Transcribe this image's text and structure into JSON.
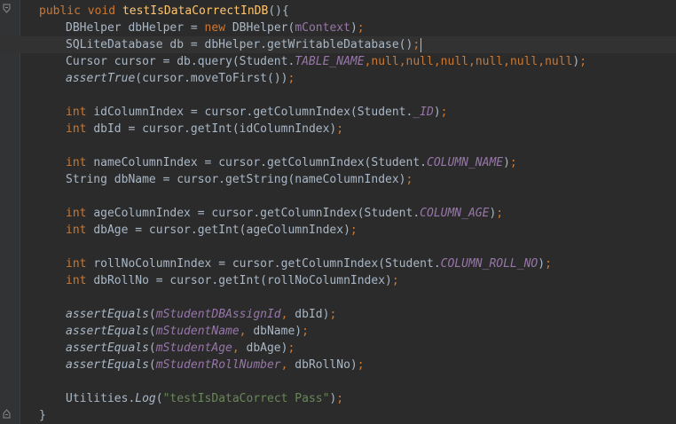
{
  "editor": {
    "lines": [
      [
        [
          "kw",
          "public "
        ],
        [
          "kw",
          "void "
        ],
        [
          "fn",
          "testIsDataCorrectInDB"
        ],
        [
          "plain",
          "(){"
        ]
      ],
      [
        [
          "plain",
          "DBHelper dbHelper = "
        ],
        [
          "kw",
          "new "
        ],
        [
          "plain",
          "DBHelper("
        ],
        [
          "mfield",
          "mContext"
        ],
        [
          "plain",
          ")"
        ],
        [
          "punc",
          ";"
        ]
      ],
      [
        [
          "plain",
          "SQLiteDatabase db = dbHelper.getWritableDatabase()"
        ],
        [
          "punc",
          ";"
        ]
      ],
      [
        [
          "plain",
          "Cursor cursor = db.query(Student."
        ],
        [
          "field",
          "TABLE_NAME"
        ],
        [
          "punc",
          ","
        ],
        [
          "kw",
          "null"
        ],
        [
          "punc",
          ","
        ],
        [
          "kw",
          "null"
        ],
        [
          "punc",
          ","
        ],
        [
          "kw",
          "null"
        ],
        [
          "punc",
          ","
        ],
        [
          "kw",
          "null"
        ],
        [
          "punc",
          ","
        ],
        [
          "kw",
          "null"
        ],
        [
          "punc",
          ","
        ],
        [
          "kw",
          "null"
        ],
        [
          "plain",
          ")"
        ],
        [
          "punc",
          ";"
        ]
      ],
      [
        [
          "static",
          "assertTrue"
        ],
        [
          "plain",
          "(cursor.moveToFirst())"
        ],
        [
          "punc",
          ";"
        ]
      ],
      [],
      [
        [
          "kw",
          "int "
        ],
        [
          "plain",
          "idColumnIndex = cursor.getColumnIndex(Student."
        ],
        [
          "field",
          "_ID"
        ],
        [
          "plain",
          ")"
        ],
        [
          "punc",
          ";"
        ]
      ],
      [
        [
          "kw",
          "int "
        ],
        [
          "plain",
          "dbId = cursor.getInt(idColumnIndex)"
        ],
        [
          "punc",
          ";"
        ]
      ],
      [],
      [
        [
          "kw",
          "int "
        ],
        [
          "plain",
          "nameColumnIndex = cursor.getColumnIndex(Student."
        ],
        [
          "field",
          "COLUMN_NAME"
        ],
        [
          "plain",
          ")"
        ],
        [
          "punc",
          ";"
        ]
      ],
      [
        [
          "plain",
          "String dbName = cursor.getString(nameColumnIndex)"
        ],
        [
          "punc",
          ";"
        ]
      ],
      [],
      [
        [
          "kw",
          "int "
        ],
        [
          "plain",
          "ageColumnIndex = cursor.getColumnIndex(Student."
        ],
        [
          "field",
          "COLUMN_AGE"
        ],
        [
          "plain",
          ")"
        ],
        [
          "punc",
          ";"
        ]
      ],
      [
        [
          "kw",
          "int "
        ],
        [
          "plain",
          "dbAge = cursor.getInt(ageColumnIndex)"
        ],
        [
          "punc",
          ";"
        ]
      ],
      [],
      [
        [
          "kw",
          "int "
        ],
        [
          "plain",
          "rollNoColumnIndex = cursor.getColumnIndex(Student."
        ],
        [
          "field",
          "COLUMN_ROLL_NO"
        ],
        [
          "plain",
          ")"
        ],
        [
          "punc",
          ";"
        ]
      ],
      [
        [
          "kw",
          "int "
        ],
        [
          "plain",
          "dbRollNo = cursor.getInt(rollNoColumnIndex)"
        ],
        [
          "punc",
          ";"
        ]
      ],
      [],
      [
        [
          "static",
          "assertEquals"
        ],
        [
          "plain",
          "("
        ],
        [
          "field",
          "mStudentDBAssignId"
        ],
        [
          "punc",
          ", "
        ],
        [
          "plain",
          "dbId)"
        ],
        [
          "punc",
          ";"
        ]
      ],
      [
        [
          "static",
          "assertEquals"
        ],
        [
          "plain",
          "("
        ],
        [
          "field",
          "mStudentName"
        ],
        [
          "punc",
          ", "
        ],
        [
          "plain",
          "dbName)"
        ],
        [
          "punc",
          ";"
        ]
      ],
      [
        [
          "static",
          "assertEquals"
        ],
        [
          "plain",
          "("
        ],
        [
          "field",
          "mStudentAge"
        ],
        [
          "punc",
          ", "
        ],
        [
          "plain",
          "dbAge)"
        ],
        [
          "punc",
          ";"
        ]
      ],
      [
        [
          "static",
          "assertEquals"
        ],
        [
          "plain",
          "("
        ],
        [
          "field",
          "mStudentRollNumber"
        ],
        [
          "punc",
          ", "
        ],
        [
          "plain",
          "dbRollNo)"
        ],
        [
          "punc",
          ";"
        ]
      ],
      [],
      [
        [
          "plain",
          "Utilities."
        ],
        [
          "static",
          "Log"
        ],
        [
          "plain",
          "("
        ],
        [
          "str",
          "\"testIsDataCorrect Pass\""
        ],
        [
          "plain",
          ")"
        ],
        [
          "punc",
          ";"
        ]
      ],
      [
        [
          "plain",
          "}"
        ]
      ]
    ]
  }
}
